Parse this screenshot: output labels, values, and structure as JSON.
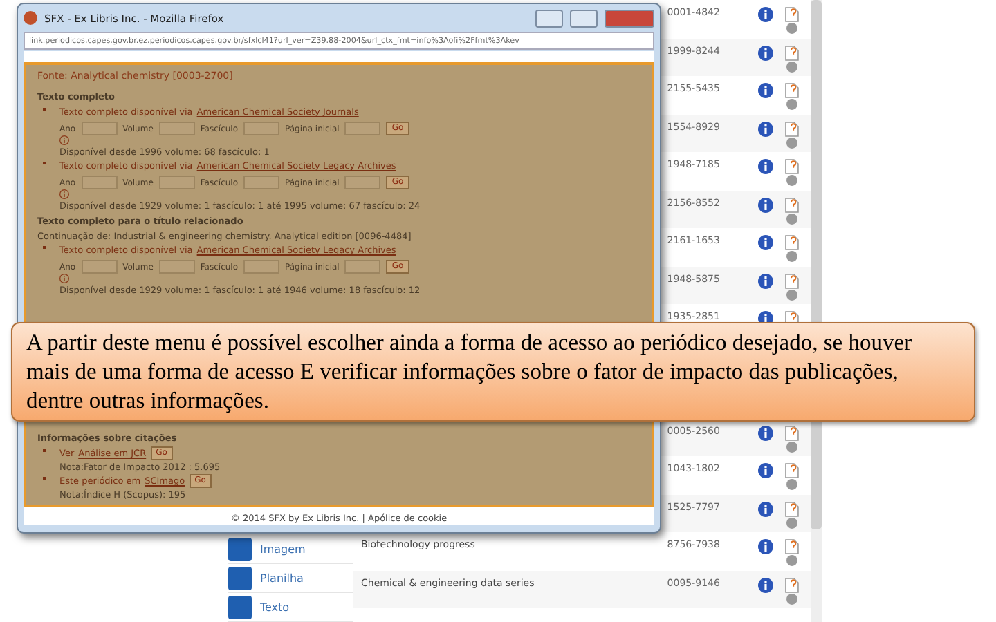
{
  "background_page": {
    "sidebar": [
      {
        "label": "Imagem"
      },
      {
        "label": "Planilha"
      },
      {
        "label": "Texto"
      }
    ],
    "rows": [
      {
        "issn": "0001-4842"
      },
      {
        "issn": "1999-8244"
      },
      {
        "issn": "2155-5435"
      },
      {
        "issn": "1554-8929"
      },
      {
        "issn": "1948-7185"
      },
      {
        "issn": "2156-8552"
      },
      {
        "issn": "2161-1653"
      },
      {
        "issn": "1948-5875"
      },
      {
        "issn": "1935-2851"
      },
      {},
      {},
      {
        "issn": "0005-2560"
      },
      {
        "issn": "1043-1802"
      },
      {
        "issn": "1525-7797"
      },
      {
        "title": "Biotechnology progress",
        "issn": "8756-7938"
      },
      {
        "title": "Chemical & engineering data series",
        "issn": "0095-9146"
      }
    ]
  },
  "popup": {
    "title": "SFX - Ex Libris Inc. - Mozilla Firefox",
    "url": "link.periodicos.capes.gov.br.ez.periodicos.capes.gov.br/sfxlcl41?url_ver=Z39.88-2004&url_ctx_fmt=info%3Aofi%2Ffmt%3Akev",
    "top_items": [
      {
        "kind": "source",
        "text": "Fonte: Analytical chemistry [0003-2700]"
      },
      {
        "kind": "heading",
        "text": "Texto completo"
      },
      {
        "kind": "link",
        "text": "Texto completo disponível via",
        "link": "American Chemical Society Journals"
      },
      {
        "kind": "form",
        "fields": [
          "Ano",
          "Volume",
          "Fascículo",
          "Página inicial"
        ],
        "button": "Go"
      },
      {
        "kind": "note",
        "text": "Disponível desde 1996 volume: 68 fascículo: 1"
      },
      {
        "kind": "link",
        "text": "Texto completo disponível via",
        "link": "American Chemical Society Legacy Archives"
      },
      {
        "kind": "form",
        "fields": [
          "Ano",
          "Volume",
          "Fascículo",
          "Página inicial"
        ],
        "button": "Go"
      },
      {
        "kind": "note",
        "text": "Disponível desde 1929 volume: 1 fascículo: 1 até 1995 volume: 67 fascículo: 24"
      },
      {
        "kind": "heading",
        "text": "Texto completo para o título relacionado"
      },
      {
        "kind": "plain",
        "text": "Continuação de: Industrial & engineering chemistry. Analytical edition [0096-4484]"
      },
      {
        "kind": "link",
        "text": "Texto completo disponível via",
        "link": "American Chemical Society Legacy Archives"
      },
      {
        "kind": "form",
        "fields": [
          "Ano",
          "Volume",
          "Fascículo",
          "Página inicial"
        ],
        "button": "Go"
      },
      {
        "kind": "note",
        "text": "Disponível desde 1929 volume: 1 fascículo: 1 até 1946 volume: 18 fascículo: 12"
      }
    ],
    "bottom_items": [
      {
        "kind": "heading",
        "text": "Informações sobre citações"
      },
      {
        "kind": "link",
        "text": "Ver",
        "link": "Análise em JCR",
        "button": "Go"
      },
      {
        "kind": "note",
        "text": "Nota:Fator de Impacto 2012 : 5.695"
      },
      {
        "kind": "link",
        "text": "Este periódico em",
        "link": "SCImago",
        "button": "Go"
      },
      {
        "kind": "note",
        "text": "Nota:Índice H (Scopus): 195"
      }
    ],
    "footer": "© 2014 SFX by Ex Libris Inc. | Apólice de cookie"
  },
  "callout": {
    "text": "A partir deste menu é possível escolher ainda a forma de acesso ao periódico desejado, se houver mais de uma forma de acesso E verificar informações sobre o fator de impacto das publicações, dentre outras informações."
  }
}
